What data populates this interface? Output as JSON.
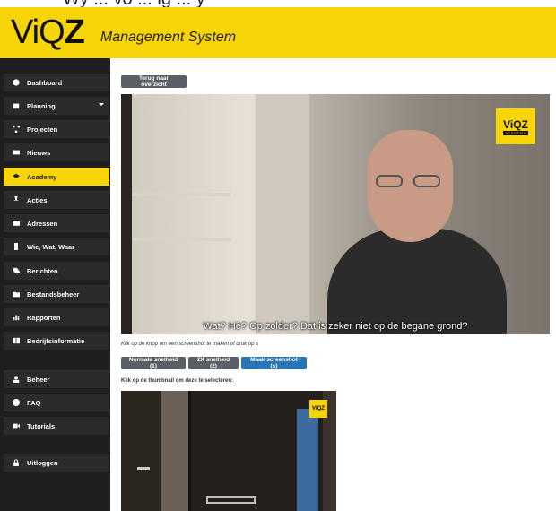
{
  "top_strip_text": "Wy ... vo ... ig ... y",
  "header": {
    "logo_text_light": "ViQ",
    "logo_text_bold": "Z",
    "title": "Management System"
  },
  "sidebar": {
    "items": [
      {
        "label": "Dashboard",
        "icon": "dashboard-icon"
      },
      {
        "label": "Planning",
        "icon": "calendar-icon",
        "has_caret": true
      },
      {
        "label": "Projecten",
        "icon": "sitemap-icon"
      },
      {
        "label": "Nieuws",
        "icon": "newspaper-icon"
      },
      {
        "label": "Academy",
        "icon": "graduation-cap-icon",
        "active": true
      },
      {
        "label": "Acties",
        "icon": "thumbtack-icon"
      },
      {
        "label": "Adressen",
        "icon": "address-card-icon"
      },
      {
        "label": "Wie, Wat, Waar",
        "icon": "mobile-icon"
      },
      {
        "label": "Berichten",
        "icon": "comments-icon"
      },
      {
        "label": "Bestandsbeheer",
        "icon": "folder-icon"
      },
      {
        "label": "Rapporten",
        "icon": "chart-icon"
      },
      {
        "label": "Bedrijfsinformatie",
        "icon": "book-icon"
      },
      {
        "label": "Beheer",
        "icon": "user-icon"
      },
      {
        "label": "FAQ",
        "icon": "question-icon"
      },
      {
        "label": "Tutorials",
        "icon": "video-icon"
      },
      {
        "label": "Uitloggen",
        "icon": "lock-icon"
      }
    ]
  },
  "content": {
    "back_button": "Terug naar overzicht",
    "video": {
      "subtitle": "Wat? Hè? Op zolder? Dat is zeker niet op de begane grond?",
      "brand_text": "ViQZ",
      "brand_sub": "ACADEMY"
    },
    "screenshot_hint": "Klik op de knop om een screenshot te maken of druk op s",
    "speed_buttons": [
      "Normale snelheid (1)",
      "2X snelheid (2)"
    ],
    "screenshot_button": "Maak screenshot (s)",
    "thumbnail_hint": "Klik op de thumbnail om deze te selecteren:",
    "thumbnail_brand": "ViQZ"
  },
  "colors": {
    "brand_yellow": "#f7d408",
    "sidebar_bg": "#1f1f1f",
    "primary_blue": "#2a76b4",
    "secondary_gray": "#5a5f66"
  }
}
